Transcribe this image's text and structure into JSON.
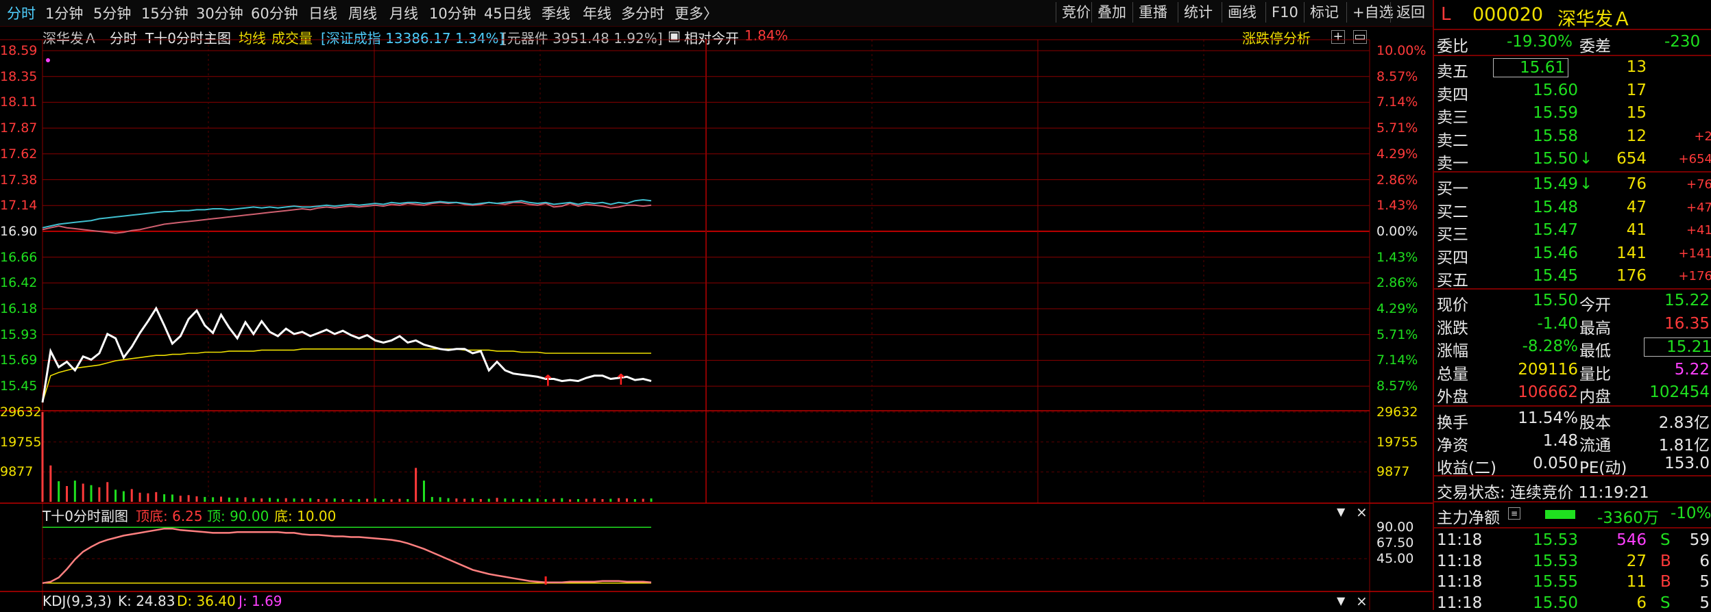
{
  "toolbar": {
    "periods": [
      "分时",
      "1分钟",
      "5分钟",
      "15分钟",
      "30分钟",
      "60分钟",
      "日线",
      "周线",
      "月线",
      "10分钟",
      "45日线",
      "季线",
      "年线",
      "多分时",
      "更多〉"
    ],
    "right_buttons": [
      "竞价",
      "叠加",
      "重播",
      "统计",
      "画线",
      "F10",
      "标记",
      "+自选",
      "返回"
    ]
  },
  "info_bar": {
    "stock": "深华发Ａ",
    "mode": "分时",
    "main": "T十0分时主图",
    "avg": "均线",
    "vol": "成交量",
    "index": "[深证成指 13386.17 1.34%]",
    "sector": "[元器件 3951.48 1.92%]",
    "rel_open_label": "相对今开",
    "rel_open_value": "1.84%",
    "analysis": "涨跌停分析"
  },
  "price_axis": {
    "left": [
      "18.59",
      "18.35",
      "18.11",
      "17.87",
      "17.62",
      "17.38",
      "17.14",
      "16.90",
      "16.66",
      "16.42",
      "16.18",
      "15.93",
      "15.69",
      "15.45"
    ],
    "right": [
      "10.00%",
      "8.57%",
      "7.14%",
      "5.71%",
      "4.29%",
      "2.86%",
      "1.43%",
      "0.00%",
      "1.43%",
      "2.86%",
      "4.29%",
      "5.71%",
      "7.14%",
      "8.57%"
    ],
    "ref_price": 16.9
  },
  "volume_axis": {
    "left": [
      "29632",
      "19755",
      "9877"
    ],
    "right": [
      "29632",
      "19755",
      "9877"
    ]
  },
  "sub1": {
    "title": "T十0分时副图",
    "top_label": "顶底: 6.25",
    "top": "顶: 90.00",
    "bottom": "底: 10.00",
    "axis": [
      "90.00",
      "67.50",
      "45.00"
    ]
  },
  "sub2": {
    "title": "KDJ(9,3,3)",
    "k": "K: 24.83",
    "d": "D: 36.40",
    "j": "J: 1.69"
  },
  "chart_data": {
    "type": "line",
    "ylim": [
      15.21,
      18.59
    ],
    "price": [
      15.3,
      15.78,
      15.63,
      15.68,
      15.6,
      15.73,
      15.7,
      15.76,
      15.94,
      15.9,
      15.72,
      15.82,
      15.95,
      16.06,
      16.18,
      16.02,
      15.85,
      15.92,
      16.08,
      16.16,
      16.02,
      15.95,
      16.12,
      16.0,
      15.9,
      16.05,
      15.94,
      16.06,
      15.96,
      15.92,
      15.99,
      15.94,
      15.96,
      15.92,
      15.95,
      15.98,
      15.94,
      15.97,
      15.93,
      15.9,
      15.93,
      15.88,
      15.86,
      15.88,
      15.92,
      15.86,
      15.88,
      15.84,
      15.82,
      15.8,
      15.79,
      15.8,
      15.8,
      15.76,
      15.78,
      15.6,
      15.68,
      15.6,
      15.57,
      15.56,
      15.55,
      15.54,
      15.52,
      15.52,
      15.5,
      15.51,
      15.5,
      15.53,
      15.55,
      15.55,
      15.52,
      15.53,
      15.54,
      15.51,
      15.52,
      15.5
    ],
    "avg": [
      15.3,
      15.55,
      15.58,
      15.6,
      15.62,
      15.63,
      15.64,
      15.65,
      15.67,
      15.69,
      15.7,
      15.71,
      15.72,
      15.73,
      15.74,
      15.74,
      15.75,
      15.75,
      15.76,
      15.76,
      15.77,
      15.77,
      15.77,
      15.78,
      15.78,
      15.78,
      15.78,
      15.79,
      15.79,
      15.79,
      15.79,
      15.79,
      15.8,
      15.8,
      15.8,
      15.8,
      15.8,
      15.8,
      15.8,
      15.8,
      15.8,
      15.8,
      15.8,
      15.8,
      15.8,
      15.8,
      15.8,
      15.8,
      15.8,
      15.8,
      15.8,
      15.8,
      15.79,
      15.79,
      15.79,
      15.79,
      15.78,
      15.78,
      15.78,
      15.77,
      15.77,
      15.77,
      15.76,
      15.76,
      15.76,
      15.76,
      15.76,
      15.76,
      15.76,
      15.76,
      15.76,
      15.76,
      15.76,
      15.76,
      15.76,
      15.76
    ],
    "index_pct": [
      0.2,
      0.3,
      0.4,
      0.45,
      0.5,
      0.55,
      0.6,
      0.7,
      0.75,
      0.8,
      0.85,
      0.9,
      0.95,
      1.0,
      1.05,
      1.1,
      1.1,
      1.15,
      1.15,
      1.2,
      1.2,
      1.25,
      1.25,
      1.2,
      1.25,
      1.3,
      1.35,
      1.3,
      1.35,
      1.3,
      1.35,
      1.4,
      1.35,
      1.35,
      1.4,
      1.45,
      1.4,
      1.45,
      1.5,
      1.45,
      1.5,
      1.55,
      1.5,
      1.6,
      1.55,
      1.6,
      1.6,
      1.55,
      1.6,
      1.65,
      1.6,
      1.6,
      1.55,
      1.5,
      1.55,
      1.6,
      1.55,
      1.6,
      1.65,
      1.7,
      1.6,
      1.55,
      1.6,
      1.5,
      1.55,
      1.6,
      1.5,
      1.6,
      1.55,
      1.6,
      1.5,
      1.6,
      1.55,
      1.7,
      1.75,
      1.7
    ],
    "sector_pct": [
      0.1,
      0.2,
      0.3,
      0.2,
      0.15,
      0.1,
      0.05,
      0.0,
      -0.05,
      -0.1,
      -0.05,
      0.05,
      0.1,
      0.2,
      0.3,
      0.4,
      0.45,
      0.5,
      0.55,
      0.6,
      0.65,
      0.7,
      0.75,
      0.8,
      0.85,
      0.9,
      0.95,
      1.0,
      1.05,
      1.1,
      1.15,
      1.2,
      1.25,
      1.2,
      1.3,
      1.35,
      1.3,
      1.35,
      1.4,
      1.35,
      1.4,
      1.45,
      1.4,
      1.5,
      1.45,
      1.55,
      1.5,
      1.45,
      1.55,
      1.6,
      1.55,
      1.6,
      1.5,
      1.45,
      1.5,
      1.6,
      1.55,
      1.5,
      1.6,
      1.6,
      1.5,
      1.45,
      1.55,
      1.35,
      1.4,
      1.55,
      1.4,
      1.5,
      1.45,
      1.4,
      1.3,
      1.35,
      1.45,
      1.45,
      1.4,
      1.45
    ],
    "volume": [
      29632,
      12000,
      6800,
      5200,
      7000,
      6000,
      5500,
      4800,
      6500,
      4000,
      3500,
      4200,
      3000,
      2800,
      3200,
      2500,
      2400,
      2000,
      2200,
      1800,
      1600,
      1500,
      1700,
      1400,
      1300,
      1500,
      1200,
      1100,
      1300,
      1000,
      1200,
      1100,
      1000,
      1200,
      900,
      1000,
      1100,
      900,
      800,
      900,
      1000,
      1100,
      900,
      800,
      1000,
      900,
      11200,
      7000,
      1600,
      1500,
      1200,
      1100,
      1000,
      1200,
      900,
      1000,
      1300,
      1100,
      1000,
      900,
      1000,
      1100,
      900,
      1000,
      1200,
      800,
      900,
      1000,
      1100,
      900,
      1000,
      1200,
      1100,
      900,
      1000,
      1100
    ],
    "sub1_line": [
      10,
      12,
      18,
      30,
      44,
      55,
      62,
      68,
      72,
      75,
      78,
      80,
      82,
      84,
      86,
      88,
      88,
      86,
      85,
      84,
      83,
      82,
      82,
      82,
      83,
      83,
      83,
      83,
      83,
      83,
      82,
      82,
      80,
      79,
      79,
      78,
      77,
      77,
      76,
      76,
      75,
      74,
      73,
      72,
      70,
      67,
      63,
      59,
      54,
      49,
      44,
      39,
      34,
      29,
      26,
      23,
      21,
      19,
      17,
      15,
      13,
      12,
      11,
      11,
      11,
      12,
      12,
      12,
      12,
      13,
      13,
      13,
      12,
      12,
      12,
      11
    ],
    "sub1_ylim": [
      0,
      100
    ]
  },
  "panel": {
    "title_L": "L",
    "code": "000020",
    "name": "深华发Ａ",
    "weibi_label": "委比",
    "weibi": "-19.30%",
    "weicha_label": "委差",
    "weicha": "-230",
    "asks": [
      {
        "label": "卖五",
        "price": "15.61",
        "vol": "13",
        "chg": ""
      },
      {
        "label": "卖四",
        "price": "15.60",
        "vol": "17",
        "chg": ""
      },
      {
        "label": "卖三",
        "price": "15.59",
        "vol": "15",
        "chg": ""
      },
      {
        "label": "卖二",
        "price": "15.58",
        "vol": "12",
        "chg": "+2"
      },
      {
        "label": "卖一",
        "price": "15.50",
        "vol": "654",
        "chg": "+654",
        "arrow": "↓"
      }
    ],
    "bids": [
      {
        "label": "买一",
        "price": "15.49",
        "vol": "76",
        "chg": "+76",
        "arrow": "↓"
      },
      {
        "label": "买二",
        "price": "15.48",
        "vol": "47",
        "chg": "+47"
      },
      {
        "label": "买三",
        "price": "15.47",
        "vol": "41",
        "chg": "+41"
      },
      {
        "label": "买四",
        "price": "15.46",
        "vol": "141",
        "chg": "+141"
      },
      {
        "label": "买五",
        "price": "15.45",
        "vol": "176",
        "chg": "+176"
      }
    ],
    "stats": [
      {
        "l1": "现价",
        "v1": "15.50",
        "c1": "green",
        "l2": "今开",
        "v2": "15.22",
        "c2": "green"
      },
      {
        "l1": "涨跌",
        "v1": "-1.40",
        "c1": "green",
        "l2": "最高",
        "v2": "16.35",
        "c2": "red"
      },
      {
        "l1": "涨幅",
        "v1": "-8.28%",
        "c1": "green",
        "l2": "最低",
        "v2": "15.21",
        "c2": "green"
      },
      {
        "l1": "总量",
        "v1": "209116",
        "c1": "yellow",
        "l2": "量比",
        "v2": "5.22",
        "c2": "magenta"
      },
      {
        "l1": "外盘",
        "v1": "106662",
        "c1": "red",
        "l2": "内盘",
        "v2": "102454",
        "c2": "green"
      }
    ],
    "stats2": [
      {
        "l1": "换手",
        "v1": "11.54%",
        "l2": "股本",
        "v2": "2.83亿"
      },
      {
        "l1": "净资",
        "v1": "1.48",
        "l2": "流通",
        "v2": "1.81亿"
      },
      {
        "l1": "收益(二)",
        "v1": "0.050",
        "l2": "PE(动)",
        "v2": "153.0"
      }
    ],
    "trade_state": "交易状态: 连续竞价 11:19:21",
    "main_flow_label": "主力净额",
    "main_flow": "-3360万",
    "main_flow_pct": "-10%",
    "ticks": [
      {
        "time": "11:18",
        "price": "15.53",
        "vol": "546",
        "side": "S",
        "cnt": "59",
        "vc": "magenta"
      },
      {
        "time": "11:18",
        "price": "15.53",
        "vol": "27",
        "side": "B",
        "cnt": "6",
        "vc": "yellow"
      },
      {
        "time": "11:18",
        "price": "15.55",
        "vol": "11",
        "side": "B",
        "cnt": "5",
        "vc": "yellow"
      },
      {
        "time": "11:18",
        "price": "15.50",
        "vol": "6",
        "side": "S",
        "cnt": "5",
        "vc": "yellow"
      }
    ]
  }
}
